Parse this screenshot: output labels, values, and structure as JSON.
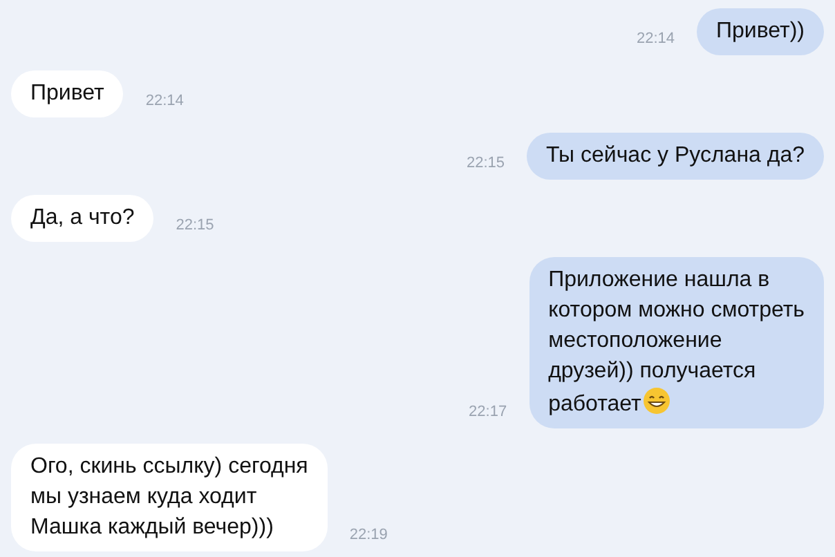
{
  "messages": [
    {
      "kind": "outgoing",
      "lines": [
        "Привет))"
      ],
      "time": "22:14",
      "emoji": false
    },
    {
      "kind": "incoming",
      "lines": [
        "Привет"
      ],
      "time": "22:14",
      "emoji": false
    },
    {
      "kind": "outgoing",
      "lines": [
        "Ты сейчас у Руслана да?"
      ],
      "time": "22:15",
      "emoji": false
    },
    {
      "kind": "incoming",
      "lines": [
        "Да, а что?"
      ],
      "time": "22:15",
      "emoji": false
    },
    {
      "kind": "outgoing",
      "lines": [
        "Приложение нашла в",
        "котором можно смотреть",
        "местоположение",
        "друзей)) получается",
        "работает"
      ],
      "time": "22:17",
      "emoji": true
    },
    {
      "kind": "incoming",
      "lines": [
        "Ого, скинь ссылку) сегодня",
        "мы узнаем куда ходит",
        "Машка каждый вечер)))"
      ],
      "time": "22:19",
      "emoji": false
    }
  ]
}
